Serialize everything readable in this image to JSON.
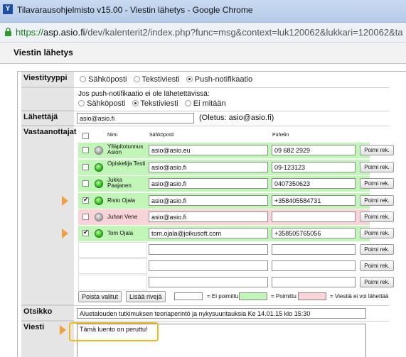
{
  "window": {
    "title": "Tilavarausohjelmisto v15.00 - Viestin lähetys - Google Chrome",
    "url_scheme": "https://",
    "url_host": "asp.asio.fi",
    "url_path": "/dev/kalenterit2/index.php?func=msg&context=luk120062&lukkari=120062&ta"
  },
  "page": {
    "title": "Viestin lähetys"
  },
  "message_type": {
    "label": "Viestityyppi",
    "options": [
      "Sähköposti",
      "Tekstiviesti",
      "Push-notifikaatio"
    ],
    "selected": "Push-notifikaatio"
  },
  "fallback": {
    "text": "Jos push-notifikaatio ei ole lähetettävissä:",
    "options": [
      "Sähköposti",
      "Tekstiviesti",
      "Ei mitään"
    ],
    "selected": "Tekstiviesti"
  },
  "sender": {
    "label": "Lähettäjä",
    "value": "asio@asio.fi",
    "default_note": "(Oletus: asio@asio.fi)"
  },
  "recipients": {
    "label": "Vastaanottajat",
    "columns": [
      "Nimi",
      "Sähköposti",
      "Puhelin"
    ],
    "pick_label": "Poimi rek.",
    "rows": [
      {
        "name": "Ylläpitotunnus Asion",
        "email": "asio@asio.eu",
        "phone": "09 682 2929",
        "state": "green",
        "checked": false,
        "status": "gray"
      },
      {
        "name": "Opiskelija Testi",
        "email": "asio@asio.fi",
        "phone": "09-123123",
        "state": "green",
        "checked": false,
        "status": "green"
      },
      {
        "name": "Jukka Paajanen",
        "email": "asio@asio.fi",
        "phone": "0407350623",
        "state": "green",
        "checked": false,
        "status": "green"
      },
      {
        "name": "Risto Ojala",
        "email": "asio@asio.fi",
        "phone": "+358405584731",
        "state": "green",
        "checked": true,
        "status": "green"
      },
      {
        "name": "Juhan Vene",
        "email": "asio@asio.fi",
        "phone": "",
        "state": "pink",
        "checked": false,
        "status": "gray"
      },
      {
        "name": "Tom Ojala",
        "email": "tom.ojala@joikusoft.com",
        "phone": "+358505765056",
        "state": "green",
        "checked": true,
        "status": "green"
      }
    ],
    "remove_selected": "Poista valitut",
    "add_rows": "Lisää rivejä",
    "legend": [
      "= Ei poimittu",
      "= Poimittu",
      "= Viestiä ei voi lähettää"
    ]
  },
  "subject": {
    "label": "Otsikko",
    "value": "Aluetalouden tutkimuksen teoriaperintö ja nykysuuntauksia Ke 14.01.15 klo 15:30"
  },
  "message": {
    "label": "Viesti",
    "value": "Tämä luento on peruttu!"
  },
  "colors": {
    "green_row": "#c2f5b8",
    "pink_row": "#f8d4d8",
    "arrow": "#f0a040",
    "highlight": "#f2b81d"
  }
}
